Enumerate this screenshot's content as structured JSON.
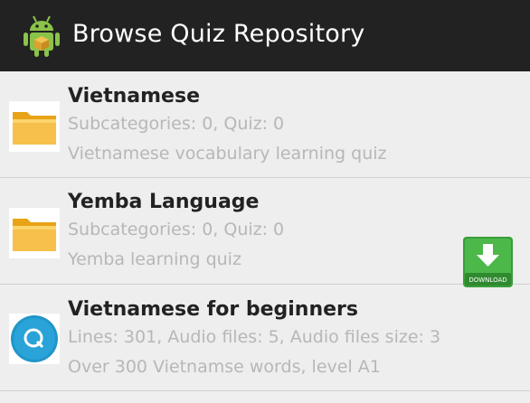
{
  "actionbar": {
    "title": "Browse Quiz Repository",
    "app_icon": "android-icon"
  },
  "items": [
    {
      "name": "Vietnamese",
      "info": "Subcategories: 0, Quiz: 0",
      "description": "Vietnamese vocabulary learning quiz",
      "icon": "folder-icon"
    },
    {
      "name": "Yemba Language",
      "info": "Subcategories: 0, Quiz: 0",
      "description": "Yemba learning quiz",
      "icon": "folder-icon"
    },
    {
      "name": "Vietnamese for beginners",
      "info": "Lines: 301, Audio files: 5, Audio files size: 3",
      "description": "Over 300 Vietnamse words, level A1",
      "icon": "quiz-q-icon",
      "download_label": "DOWNLOAD"
    }
  ]
}
